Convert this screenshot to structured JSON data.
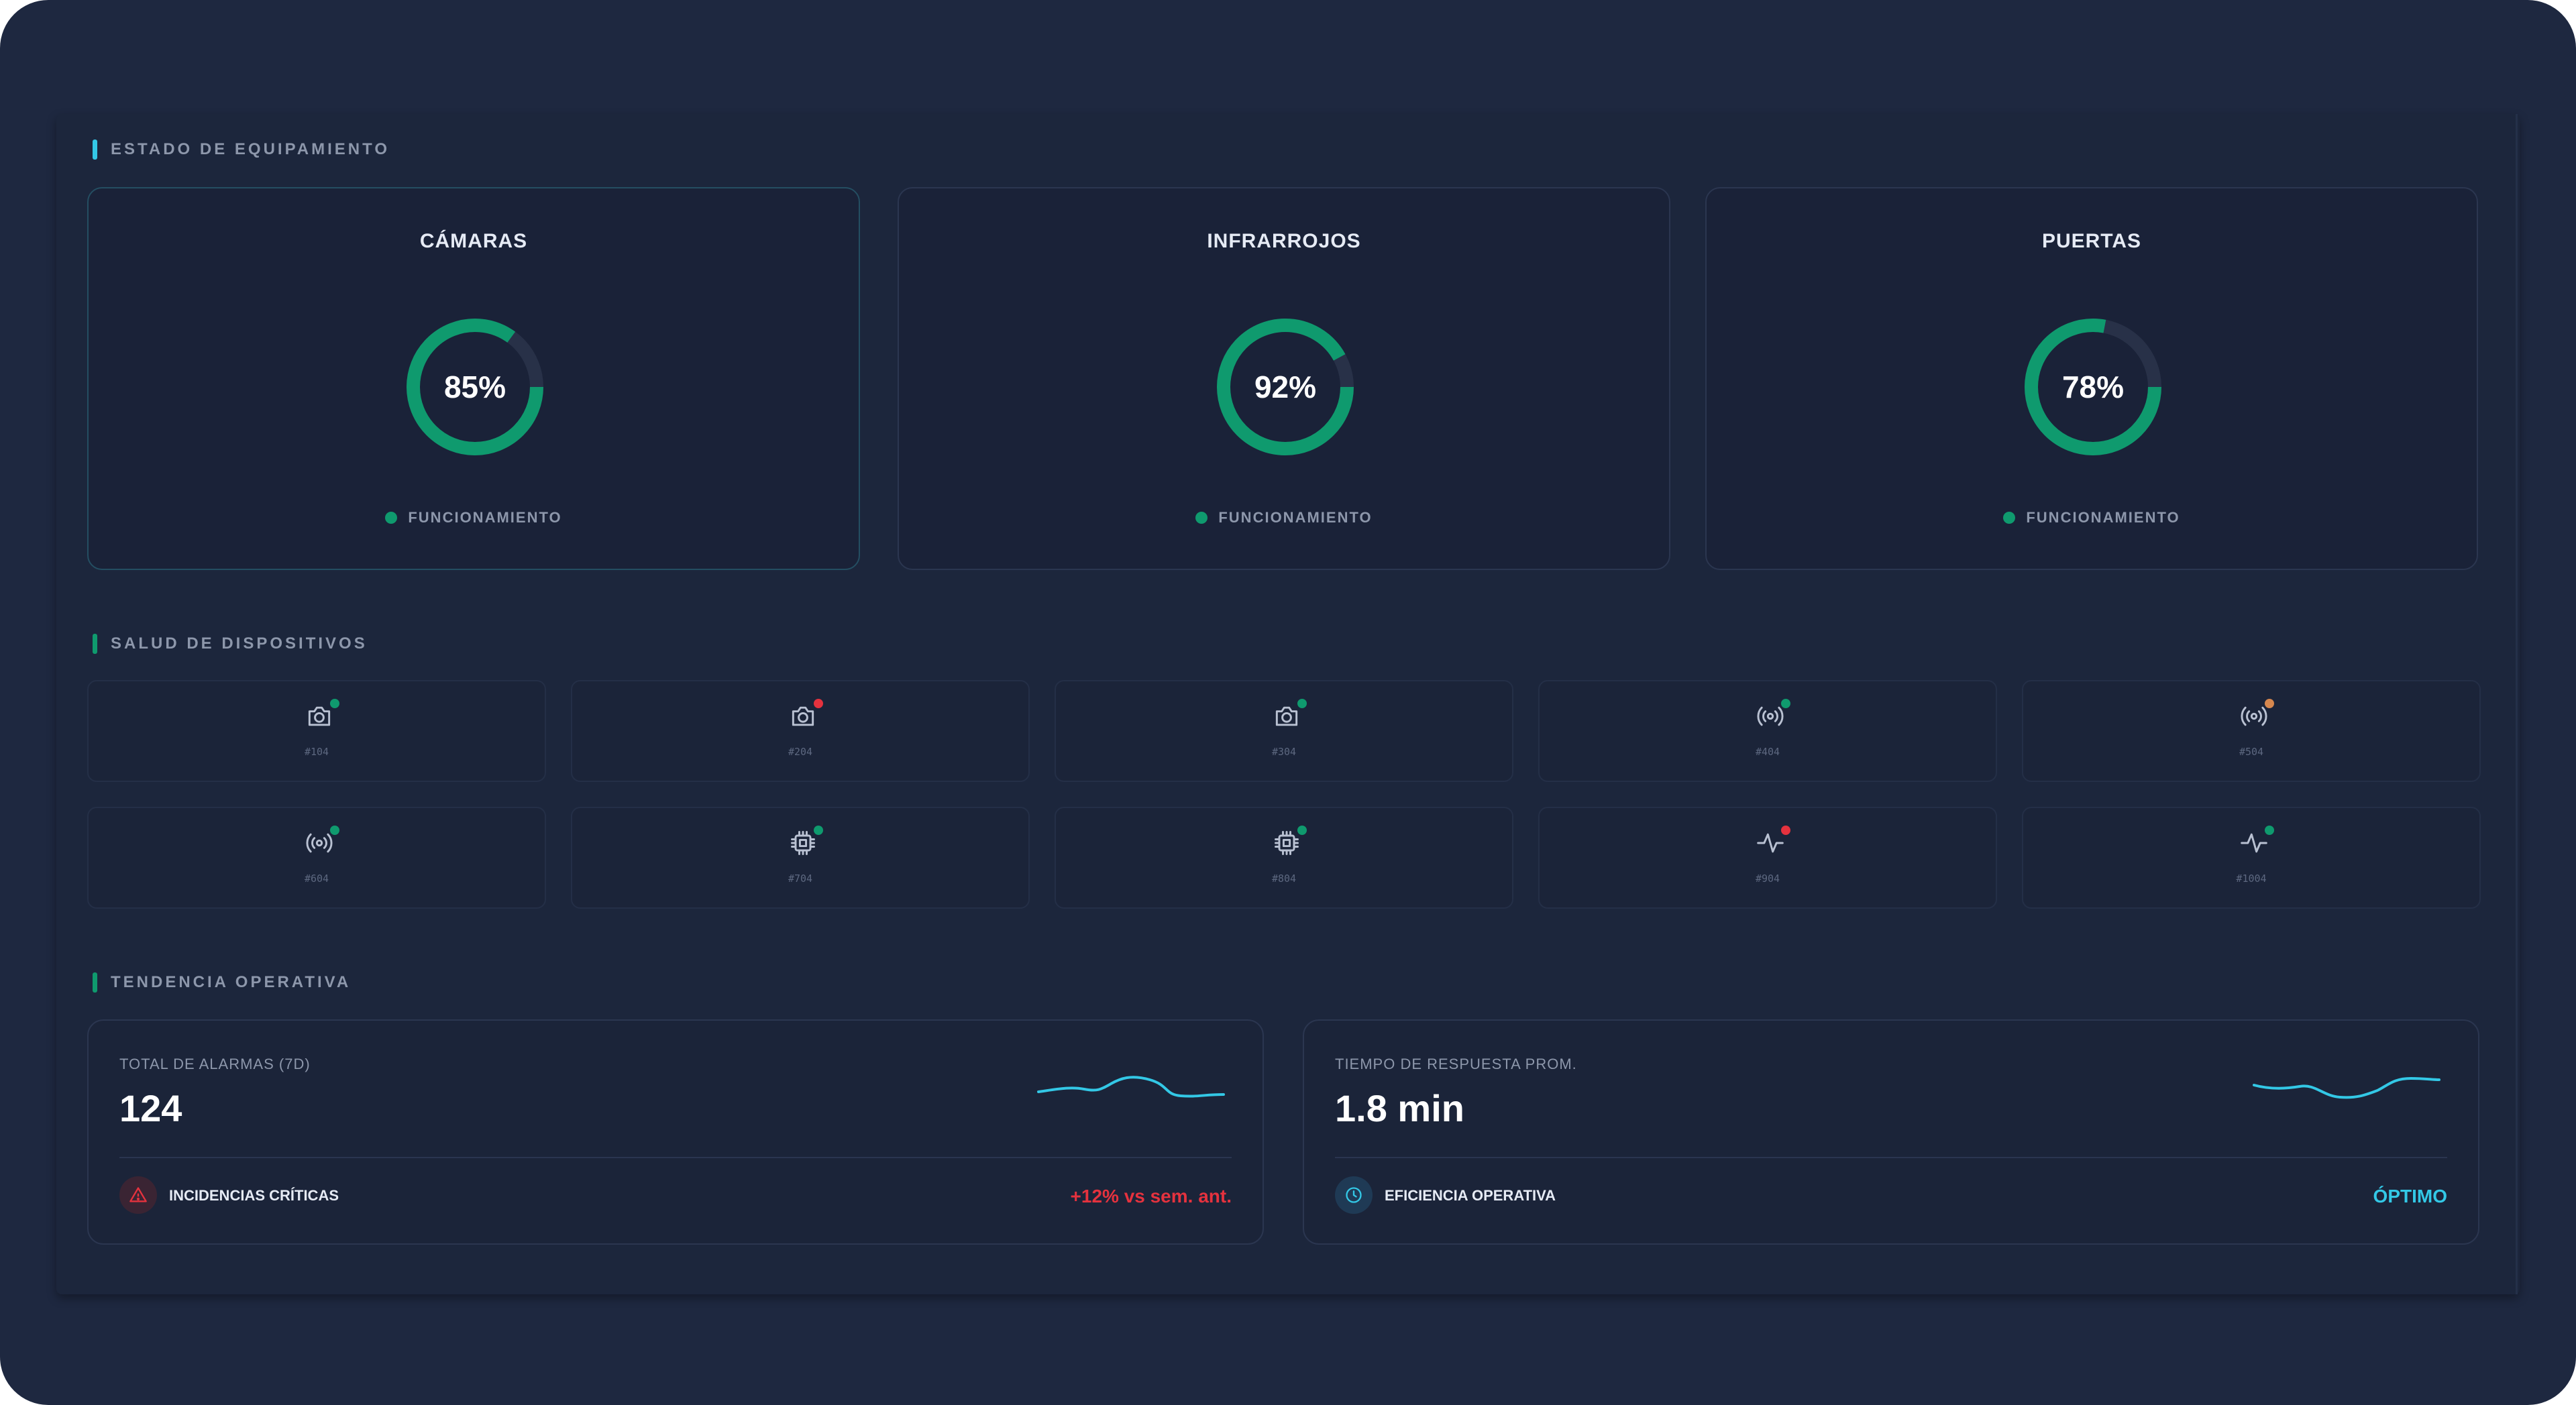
{
  "colors": {
    "accent": "#33c8e6",
    "ok": "#0f9a6e",
    "critical": "#e5323e",
    "warning": "#d6874e",
    "track": "#283148"
  },
  "sections": {
    "equipment": "ESTADO DE EQUIPAMIENTO",
    "devices": "SALUD DE DISPOSITIVOS",
    "trend": "TENDENCIA OPERATIVA"
  },
  "equipment": [
    {
      "title": "CÁMARAS",
      "percent": 85,
      "value_label": "85%",
      "status": "FUNCIONAMIENTO"
    },
    {
      "title": "INFRARROJOS",
      "percent": 92,
      "value_label": "92%",
      "status": "FUNCIONAMIENTO"
    },
    {
      "title": "PUERTAS",
      "percent": 78,
      "value_label": "78%",
      "status": "FUNCIONAMIENTO"
    }
  ],
  "devices": [
    {
      "code": "#104",
      "icon": "camera-icon",
      "status": "ok"
    },
    {
      "code": "#204",
      "icon": "camera-icon",
      "status": "critical"
    },
    {
      "code": "#304",
      "icon": "camera-icon",
      "status": "ok"
    },
    {
      "code": "#404",
      "icon": "infrared-sensor-icon",
      "status": "ok"
    },
    {
      "code": "#504",
      "icon": "infrared-sensor-icon",
      "status": "warning"
    },
    {
      "code": "#604",
      "icon": "infrared-sensor-icon",
      "status": "ok"
    },
    {
      "code": "#704",
      "icon": "chip-icon",
      "status": "ok"
    },
    {
      "code": "#804",
      "icon": "chip-icon",
      "status": "ok"
    },
    {
      "code": "#904",
      "icon": "pulse-icon",
      "status": "critical"
    },
    {
      "code": "#1004",
      "icon": "pulse-icon",
      "status": "ok"
    }
  ],
  "trend": {
    "alarms": {
      "label": "TOTAL DE ALARMAS (7D)",
      "value": "124",
      "footer_label": "INCIDENCIAS CRÍTICAS",
      "footer_icon": "warning-triangle-icon",
      "delta": "+12% vs sem. ant."
    },
    "response": {
      "label": "TIEMPO DE RESPUESTA PROM.",
      "value": "1.8 min",
      "footer_label": "EFICIENCIA OPERATIVA",
      "footer_icon": "clock-icon",
      "status": "ÓPTIMO"
    }
  }
}
